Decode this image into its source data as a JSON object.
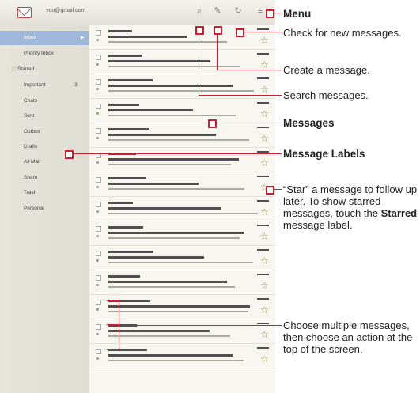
{
  "topbar": {
    "account": "you@gmail.com",
    "icons": [
      "mail-icon",
      "search-icon",
      "compose-icon",
      "refresh-icon",
      "menu-icon"
    ]
  },
  "sidebar": {
    "labels": [
      "Inbox",
      "Priority Inbox",
      "Starred",
      "Important",
      "Chats",
      "Sent",
      "Outbox",
      "Drafts",
      "All Mail",
      "Spam",
      "Trash",
      "Personal"
    ],
    "important_count": "3"
  },
  "annotations": {
    "menu": "Menu",
    "check": "Check for new messages.",
    "create": "Create a message.",
    "search": "Search messages.",
    "messages": "Messages",
    "labels": "Message Labels",
    "star_part1": "“Star” a message to follow up later. To show starred messages, touch the",
    "star_bold": "Starred",
    "star_part2": "message label.",
    "multi": "Choose multiple messages, then choose an action at the top of the screen."
  },
  "colors": {
    "accent": "#c8202f",
    "selected": "#9fb7d9"
  }
}
